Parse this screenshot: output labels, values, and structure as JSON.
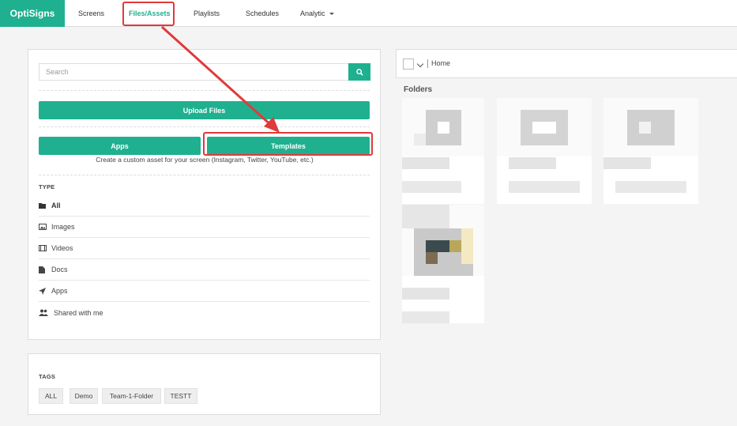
{
  "nav": {
    "brand": "OptiSigns",
    "items": [
      {
        "label": "Screens"
      },
      {
        "label": "Files/Assets"
      },
      {
        "label": "Playlists"
      },
      {
        "label": "Schedules"
      },
      {
        "label": "Analytic"
      }
    ]
  },
  "sidebar": {
    "search_placeholder": "Search",
    "search_value": "",
    "upload_label": "Upload Files",
    "apps_label": "Apps",
    "templates_label": "Templates",
    "templates_hint": "Create a custom asset for your screen (Instagram, Twitter, YouTube, etc.)",
    "type_heading": "TYPE",
    "types": [
      {
        "label": "All",
        "icon": "folder-icon"
      },
      {
        "label": "Images",
        "icon": "image-icon"
      },
      {
        "label": "Videos",
        "icon": "film-icon"
      },
      {
        "label": "Docs",
        "icon": "document-icon"
      },
      {
        "label": "Apps",
        "icon": "rocket-icon"
      },
      {
        "label": "Shared with me",
        "icon": "users-icon"
      }
    ],
    "tags_heading": "TAGS",
    "tags": [
      "ALL",
      "Demo",
      "Team-1-Folder",
      "TESTT"
    ]
  },
  "main": {
    "breadcrumb": "Home",
    "folders_title": "Folders"
  },
  "colors": {
    "accent": "#1fb08f",
    "annotation": "#e03a3a"
  }
}
